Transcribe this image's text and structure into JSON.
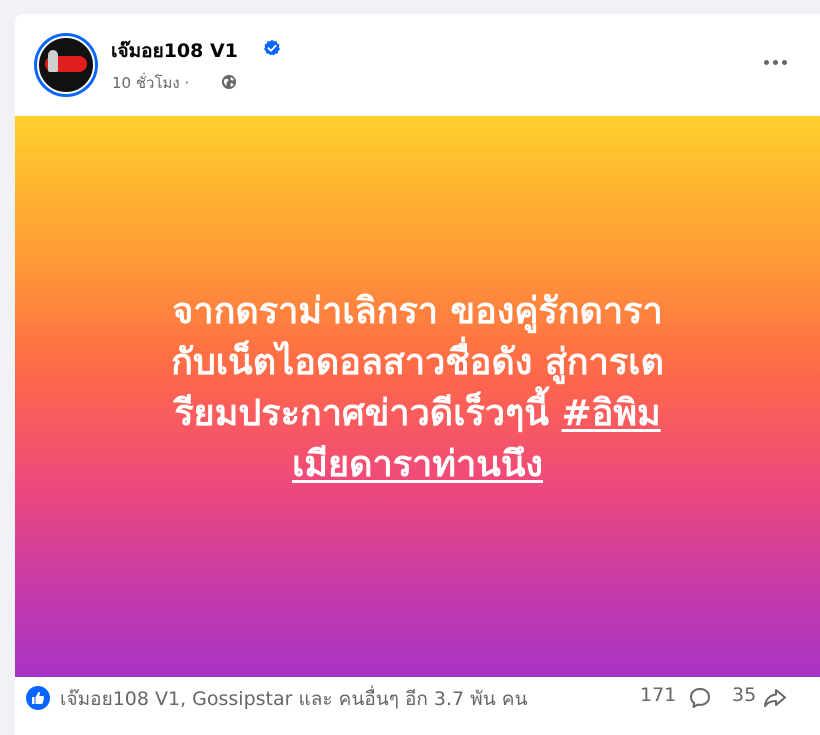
{
  "post": {
    "page_name": "เจ๊มอย108 V1",
    "time": "10 ชั่วโมง ·",
    "verified": true,
    "banner": {
      "line1": "จากดราม่าเลิกรา ของคู่รักดารา",
      "line2": "กับเน็ตไอดอลสาวชื่อดัง สู่การเต",
      "line3_text": "รียมประกาศข่าวดีเร็วๆนี้ ",
      "hashtag_part1": "#อิพิม",
      "hashtag_part2": "เมียดาราท่านนึง",
      "gradient_top": "#ffcf2c",
      "gradient_bottom": "#a833c8"
    },
    "reactions": {
      "text": "เจ๊มอย108 V1, Gossipstar และ คนอื่นๆ อีก 3.7 พัน คน",
      "comments": "171",
      "shares": "35"
    }
  },
  "icons": {
    "verified": "verified-badge-icon",
    "audience": "globe-icon",
    "more": "more-options-icon",
    "like": "like-thumb-icon",
    "comment": "comment-bubble-icon",
    "share": "share-arrow-icon"
  },
  "colors": {
    "accent": "#0866ff",
    "secondary_text": "#65676b",
    "primary_text": "#050505"
  }
}
